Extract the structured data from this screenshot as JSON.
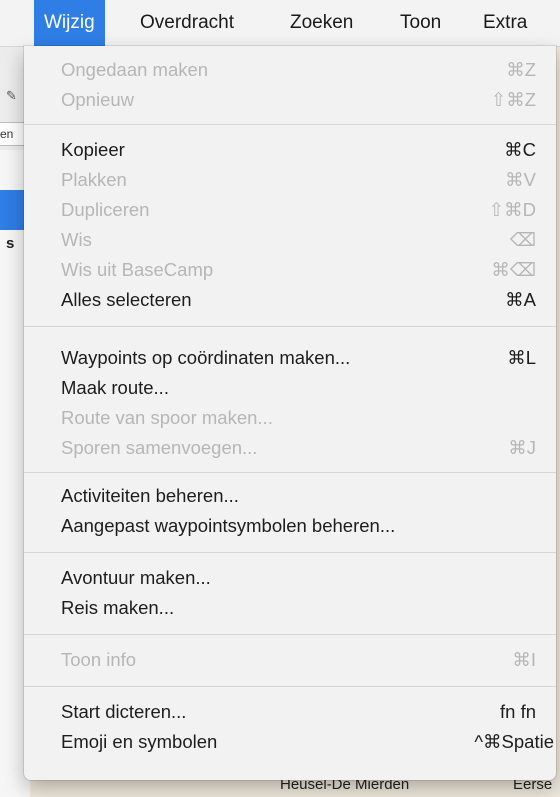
{
  "menubar": {
    "items": [
      {
        "label": "Wijzig",
        "active": true
      },
      {
        "label": "Overdracht"
      },
      {
        "label": "Zoeken"
      },
      {
        "label": "Toon"
      },
      {
        "label": "Extra"
      }
    ]
  },
  "menu": {
    "items": [
      {
        "label": "Ongedaan maken",
        "shortcut": "⌘Z",
        "enabled": false
      },
      {
        "label": "Opnieuw",
        "shortcut": "⇧⌘Z",
        "enabled": false
      },
      {
        "label": "Kopieer",
        "shortcut": "⌘C",
        "enabled": true
      },
      {
        "label": "Plakken",
        "shortcut": "⌘V",
        "enabled": false
      },
      {
        "label": "Dupliceren",
        "shortcut": "⇧⌘D",
        "enabled": false
      },
      {
        "label": "Wis",
        "shortcut": "⌫",
        "enabled": false
      },
      {
        "label": "Wis uit BaseCamp",
        "shortcut": "⌘⌫",
        "enabled": false
      },
      {
        "label": "Alles selecteren",
        "shortcut": "⌘A",
        "enabled": true
      },
      {
        "label": "Waypoints op coördinaten maken...",
        "shortcut": "⌘L",
        "enabled": true
      },
      {
        "label": "Maak route...",
        "shortcut": "",
        "enabled": true
      },
      {
        "label": "Route van spoor maken...",
        "shortcut": "",
        "enabled": false
      },
      {
        "label": "Sporen samenvoegen...",
        "shortcut": "⌘J",
        "enabled": false
      },
      {
        "label": "Activiteiten beheren...",
        "shortcut": "",
        "enabled": true
      },
      {
        "label": "Aangepast waypointsymbolen beheren...",
        "shortcut": "",
        "enabled": true
      },
      {
        "label": "Avontuur maken...",
        "shortcut": "",
        "enabled": true
      },
      {
        "label": "Reis maken...",
        "shortcut": "",
        "enabled": true
      },
      {
        "label": "Toon info",
        "shortcut": "⌘I",
        "enabled": false
      },
      {
        "label": "Start dicteren...",
        "shortcut": "fn fn",
        "enabled": true
      },
      {
        "label": "Emoji en symbolen",
        "shortcut": "^⌘Spatie",
        "enabled": true
      }
    ]
  },
  "background": {
    "field_text": "en",
    "sidebar_letter": "s",
    "map_label": "Heusel-De Mierden",
    "map_label_right": "Eerse"
  },
  "colors": {
    "accent": "#2f7ee6",
    "menu_bg": "#f2f2f2",
    "disabled_text": "#b6b6b6",
    "text": "#1d1d1d"
  }
}
